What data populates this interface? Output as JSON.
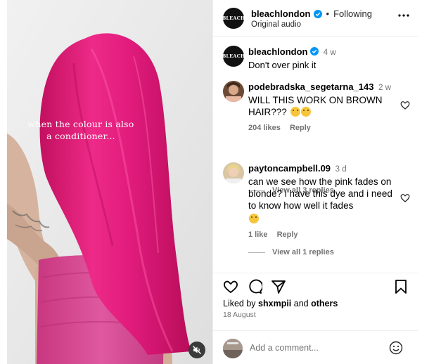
{
  "post": {
    "overlay_line1": "when the colour is also",
    "overlay_line2": "a conditioner...",
    "mute_icon": "speaker-muted-icon"
  },
  "header": {
    "brand_mark": "BLEACH",
    "username": "bleachlondon",
    "separator": "•",
    "follow_label": "Following",
    "audio_label": "Original audio",
    "more_icon": "more-dots-icon"
  },
  "caption": {
    "username": "bleachlondon",
    "time": "4 w",
    "text": "Don't over pink it"
  },
  "comments": [
    {
      "username": "podebradska_segetarna_143",
      "time": "2 w",
      "text": "WILL THIS WORK ON BROWN HAIR???",
      "likes": "204 likes",
      "reply_label": "Reply",
      "view_replies": "View all 3 replies"
    },
    {
      "username": "paytoncampbell.09",
      "time": "3 d",
      "text": "can we see how the pink fades on blonde? i have this dye and i need to know how well it fades",
      "likes": "1 like",
      "reply_label": "Reply",
      "view_replies": "View all 1 replies"
    }
  ],
  "actions": {
    "liked_prefix": "Liked by",
    "liked_user": "shxmpii",
    "liked_and": "and",
    "liked_others": "others",
    "date": "18 August"
  },
  "add_comment": {
    "placeholder": "Add a comment..."
  },
  "colors": {
    "hair_pink": "#e5197a",
    "verified_blue": "#0095f6",
    "muted_text": "#737373"
  }
}
